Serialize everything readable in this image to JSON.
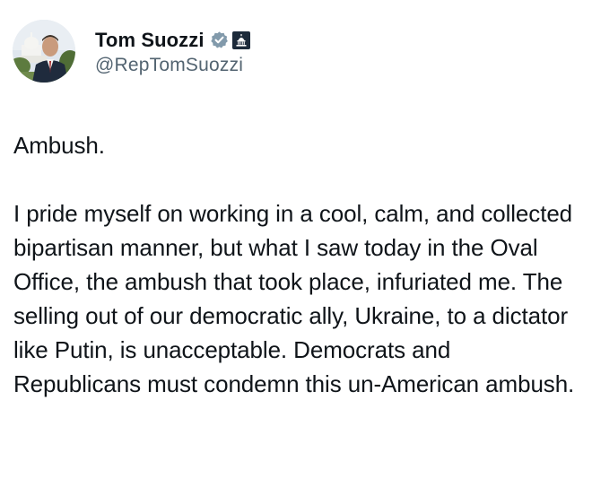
{
  "author": {
    "display_name": "Tom Suozzi",
    "handle": "@RepTomSuozzi",
    "avatar_icon": "profile-photo-capitol",
    "verified_icon": "verified-badge-icon",
    "affiliation_icon": "government-capitol-badge-icon"
  },
  "tweet": {
    "paragraphs": [
      "Ambush.",
      "I pride myself on working in a cool, calm, and collected bipartisan manner, but what I saw today in the Oval Office, the ambush that took place, infuriated me. The selling out of our democratic ally, Ukraine, to a dictator like Putin, is unacceptable. Democrats and Republicans must condemn this un-American ambush."
    ]
  },
  "colors": {
    "text": "#0f1419",
    "secondary_text": "#536471",
    "verified_badge": "#829aab",
    "gov_badge": "#1c2a3a"
  }
}
